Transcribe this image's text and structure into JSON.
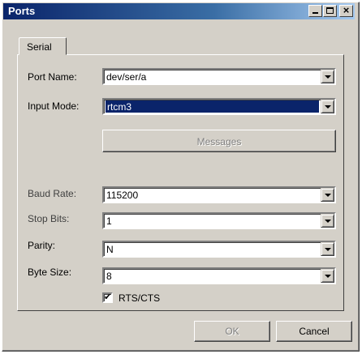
{
  "window": {
    "title": "Ports"
  },
  "tabs": [
    {
      "label": "Serial"
    }
  ],
  "fields": {
    "port_name": {
      "label": "Port Name:",
      "value": "dev/ser/a"
    },
    "input_mode": {
      "label": "Input Mode:",
      "value": "rtcm3"
    },
    "baud_rate": {
      "label": "Baud Rate:",
      "value": "115200"
    },
    "stop_bits": {
      "label": "Stop Bits:",
      "value": "1"
    },
    "parity": {
      "label": "Parity:",
      "value": "N"
    },
    "byte_size": {
      "label": "Byte Size:",
      "value": "8"
    }
  },
  "buttons": {
    "messages": "Messages",
    "ok": "OK",
    "cancel": "Cancel"
  },
  "rts_cts": {
    "label": "RTS/CTS",
    "checked": true
  },
  "colors": {
    "face": "#d4d0c8",
    "title_start": "#0a246a",
    "title_end": "#a6caf0",
    "highlight": "#0a246a"
  }
}
